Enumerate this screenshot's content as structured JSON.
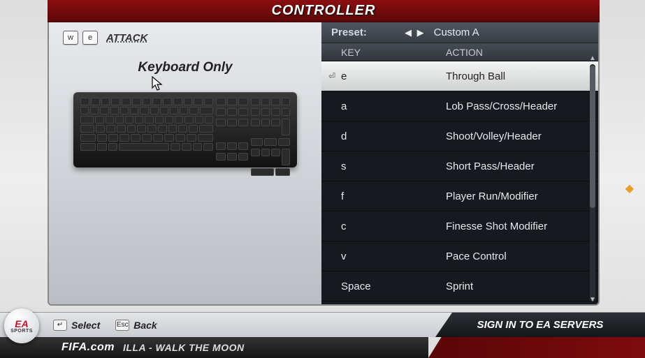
{
  "title": "CONTROLLER",
  "mode": {
    "prev_key": "w",
    "next_key": "e",
    "label": "ATTACK"
  },
  "controller_name": "Keyboard Only",
  "preset": {
    "label": "Preset:",
    "value": "Custom A"
  },
  "columns": {
    "key": "KEY",
    "action": "ACTION"
  },
  "bindings": [
    {
      "key": "e",
      "action": "Through Ball",
      "selected": true
    },
    {
      "key": "a",
      "action": "Lob Pass/Cross/Header",
      "selected": false
    },
    {
      "key": "d",
      "action": "Shoot/Volley/Header",
      "selected": false
    },
    {
      "key": "s",
      "action": "Short Pass/Header",
      "selected": false
    },
    {
      "key": "f",
      "action": "Player Run/Modifier",
      "selected": false
    },
    {
      "key": "c",
      "action": "Finesse Shot Modifier",
      "selected": false
    },
    {
      "key": "v",
      "action": "Pace Control",
      "selected": false
    },
    {
      "key": "Space",
      "action": "Sprint",
      "selected": false
    }
  ],
  "footer": {
    "select_key": "↵",
    "select_label": "Select",
    "back_key": "Esc",
    "back_label": "Back",
    "signin": "SIGN IN TO EA SERVERS",
    "ticker_brand": "FIFA.com",
    "ticker_text": "ILLA - WALK THE MOON"
  },
  "badge": {
    "top": "EA",
    "bottom": "SPORTS"
  }
}
